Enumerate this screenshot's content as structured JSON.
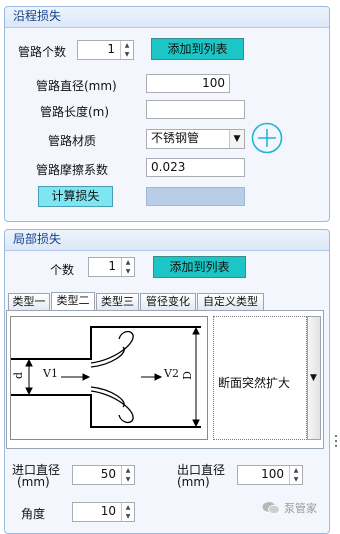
{
  "friction_panel": {
    "title": "沿程损失",
    "pipe_count_label": "管路个数",
    "pipe_count_value": "1",
    "add_to_list_label": "添加到列表",
    "diameter_label": "管路直径(mm)",
    "diameter_value": "100",
    "length_label": "管路长度(m)",
    "length_value": "",
    "material_label": "管路材质",
    "material_value": "不锈钢管",
    "friction_coef_label": "管路摩擦系数",
    "friction_coef_value": "0.023",
    "calculate_label": "计算损失",
    "result_value": ""
  },
  "local_panel": {
    "title": "局部损失",
    "count_label": "个数",
    "count_value": "1",
    "add_to_list_label": "添加到列表",
    "tabs": [
      {
        "label": "类型一"
      },
      {
        "label": "类型二"
      },
      {
        "label": "类型三"
      },
      {
        "label": "管径变化"
      },
      {
        "label": "自定义类型"
      }
    ],
    "active_tab": "类型二",
    "diagram": {
      "v1_label": "V1",
      "v2_label": "V2",
      "d_small_label": "d",
      "d_large_label": "D"
    },
    "type_selected": "断面突然扩大",
    "inlet_diameter_label_1": "进口直径",
    "inlet_diameter_label_2": "(mm)",
    "inlet_diameter_value": "50",
    "outlet_diameter_label_1": "出口直径",
    "outlet_diameter_label_2": "(mm)",
    "outlet_diameter_value": "100",
    "angle_label": "角度",
    "angle_value": "10"
  },
  "watermark": {
    "text": "泵管家"
  },
  "colors": {
    "panel_border": "#9fbadf",
    "panel_bg": "#f3f7fd",
    "header_text": "#15428b",
    "teal_button": "#1cc6c6",
    "cyan_button": "#7ee6f2",
    "plus_icon": "#1fb5d8"
  }
}
